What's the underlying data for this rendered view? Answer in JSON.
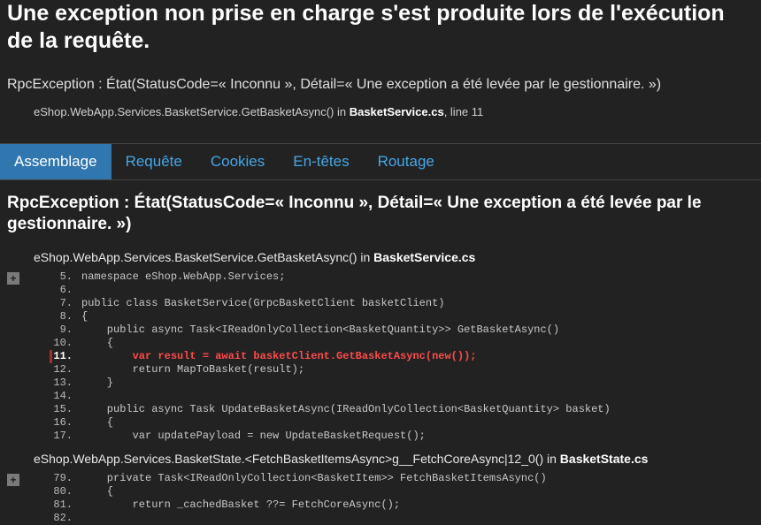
{
  "header": {
    "title": "Une exception non prise en charge s'est produite lors de l'exécution de la requête.",
    "exception_message": "RpcException : État(StatusCode=« Inconnu », Détail=« Une exception a été levée par le gestionnaire. »)",
    "stack_summary_prefix": "eShop.WebApp.Services.BasketService.GetBasketAsync() in ",
    "stack_summary_file": "BasketService.cs",
    "stack_summary_suffix": ", line 11"
  },
  "tabs": {
    "items": [
      {
        "label": "Assemblage",
        "active": true
      },
      {
        "label": "Requête",
        "active": false
      },
      {
        "label": "Cookies",
        "active": false
      },
      {
        "label": "En-têtes",
        "active": false
      },
      {
        "label": "Routage",
        "active": false
      }
    ]
  },
  "detail": {
    "title": "RpcException : État(StatusCode=« Inconnu », Détail=« Une exception a été levée par le gestionnaire. »)",
    "frames": [
      {
        "method": "eShop.WebApp.Services.BasketService.GetBasketAsync() in ",
        "file": "BasketService.cs",
        "expand": "+",
        "lines": [
          {
            "n": "5.",
            "code": "namespace eShop.WebApp.Services;",
            "hl": false
          },
          {
            "n": "6.",
            "code": "",
            "hl": false
          },
          {
            "n": "7.",
            "code": "public class BasketService(GrpcBasketClient basketClient)",
            "hl": false
          },
          {
            "n": "8.",
            "code": "{",
            "hl": false
          },
          {
            "n": "9.",
            "code": "    public async Task<IReadOnlyCollection<BasketQuantity>> GetBasketAsync()",
            "hl": false
          },
          {
            "n": "10.",
            "code": "    {",
            "hl": false
          },
          {
            "n": "11.",
            "code": "        var result = await basketClient.GetBasketAsync(new());",
            "hl": true
          },
          {
            "n": "12.",
            "code": "        return MapToBasket(result);",
            "hl": false
          },
          {
            "n": "13.",
            "code": "    }",
            "hl": false
          },
          {
            "n": "14.",
            "code": "",
            "hl": false
          },
          {
            "n": "15.",
            "code": "    public async Task UpdateBasketAsync(IReadOnlyCollection<BasketQuantity> basket)",
            "hl": false
          },
          {
            "n": "16.",
            "code": "    {",
            "hl": false
          },
          {
            "n": "17.",
            "code": "        var updatePayload = new UpdateBasketRequest();",
            "hl": false
          }
        ]
      },
      {
        "method": "eShop.WebApp.Services.BasketState.<FetchBasketItemsAsync>g__FetchCoreAsync|12_0() in ",
        "file": "BasketState.cs",
        "expand": "+",
        "lines": [
          {
            "n": "79.",
            "code": "    private Task<IReadOnlyCollection<BasketItem>> FetchBasketItemsAsync()",
            "hl": false
          },
          {
            "n": "80.",
            "code": "    {",
            "hl": false
          },
          {
            "n": "81.",
            "code": "        return _cachedBasket ??= FetchCoreAsync();",
            "hl": false
          },
          {
            "n": "82.",
            "code": "",
            "hl": false
          }
        ]
      }
    ]
  }
}
